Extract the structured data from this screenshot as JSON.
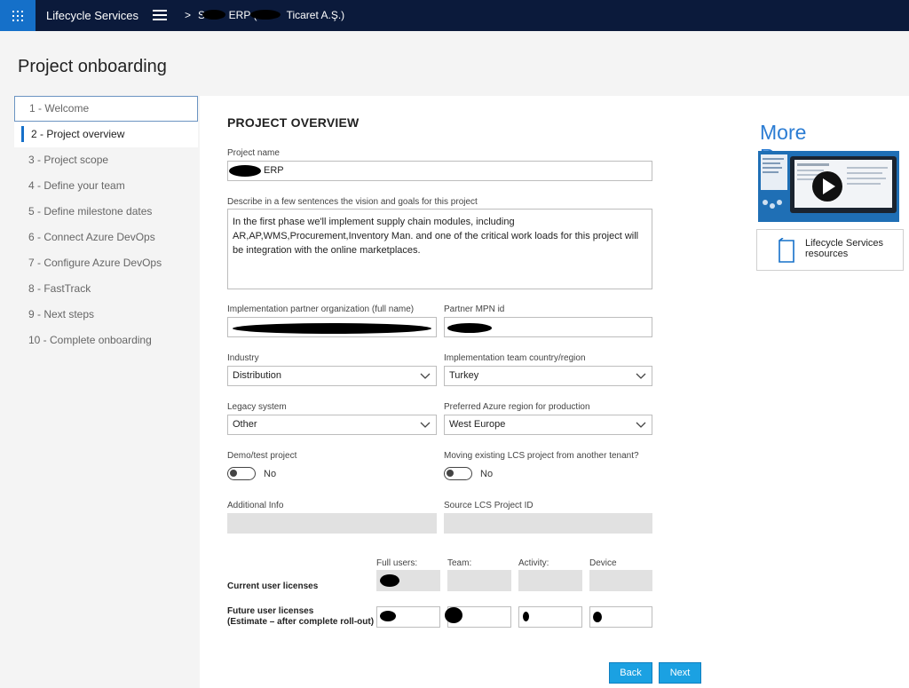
{
  "header": {
    "app_title": "Lifecycle Services",
    "breadcrumb_sep": ">",
    "breadcrumb": "S        ERP (          Ticaret A.Ş.)"
  },
  "page_title": "Project onboarding",
  "steps": [
    "1 - Welcome",
    "2 - Project overview",
    "3 - Project scope",
    "4 - Define your team",
    "5 - Define milestone dates",
    "6 - Connect Azure DevOps",
    "7 - Configure Azure DevOps",
    "8 - FastTrack",
    "9 - Next steps",
    "10 - Complete onboarding"
  ],
  "form": {
    "section_title": "PROJECT OVERVIEW",
    "project_name_label": "Project name",
    "project_name_value": "ERP",
    "description_label": "Describe in a few sentences the vision and goals for this project",
    "description_value": "In the first phase we'll implement supply chain modules, including AR,AP,WMS,Procurement,Inventory Man. and one of the critical work loads for this project will be integration with the online marketplaces.",
    "partner_org_label": "Implementation partner organization (full name)",
    "partner_mpn_label": "Partner MPN id",
    "industry_label": "Industry",
    "industry_value": "Distribution",
    "country_label": "Implementation team country/region",
    "country_value": "Turkey",
    "legacy_label": "Legacy system",
    "legacy_value": "Other",
    "azure_region_label": "Preferred Azure region for production",
    "azure_region_value": "West Europe",
    "demo_label": "Demo/test project",
    "demo_value": "No",
    "moving_label": "Moving existing LCS project from another tenant?",
    "moving_value": "No",
    "additional_info_label": "Additional Info",
    "source_lcs_label": "Source LCS Project ID",
    "licenses": {
      "headers": [
        "Full users:",
        "Team:",
        "Activity:",
        "Device"
      ],
      "current_label": "Current user licenses",
      "future_label_1": "Future user licenses",
      "future_label_2": "(Estimate – after complete roll-out)"
    }
  },
  "buttons": {
    "back": "Back",
    "next": "Next"
  },
  "resources": {
    "title": "More Resources",
    "card_label": "Lifecycle Services resources"
  },
  "colors": {
    "topbar": "#0b1a3b",
    "accent": "#1570c9",
    "button": "#1ba1e2",
    "resources_title": "#2b7cd3"
  }
}
